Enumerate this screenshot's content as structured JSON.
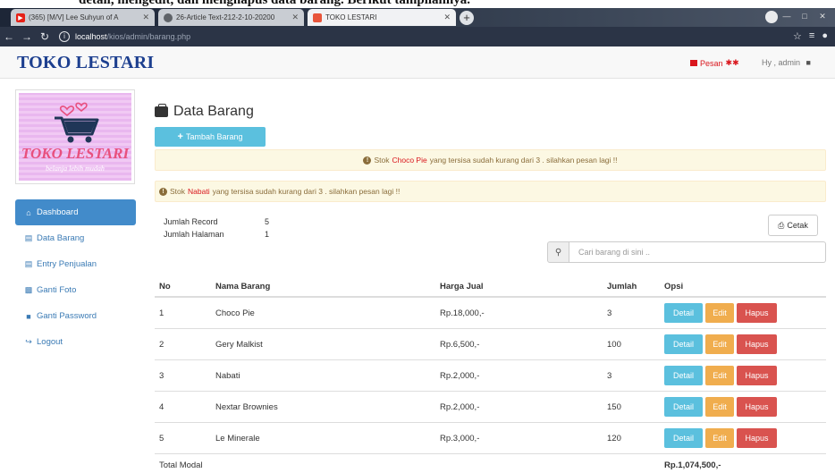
{
  "doc_fragment": "detail, mengedit, dan menghapus data barang. Berikut tampilannya.",
  "browser": {
    "tabs": [
      {
        "label": "(365) [M/V] Lee Suhyun of A",
        "favicon_color": "#e62117"
      },
      {
        "label": "26-Article Text-212-2-10-20200",
        "favicon_color": "#5f6368"
      },
      {
        "label": "TOKO LESTARI",
        "favicon_color": "#e8553b"
      }
    ],
    "address_host": "localhost",
    "address_path": "/kios/admin/barang.php"
  },
  "header": {
    "brand": "TOKO LESTARI",
    "pesan_label": "Pesan",
    "pesan_badge": "✱✱",
    "greeting": "Hy , admin"
  },
  "logo": {
    "title": "TOKO LESTARI",
    "tagline": "belanja lebih mudah"
  },
  "sidebar": {
    "items": [
      {
        "label": "Dashboard",
        "icon": "home-icon",
        "active": true
      },
      {
        "label": "Data Barang",
        "icon": "database-icon"
      },
      {
        "label": "Entry Penjualan",
        "icon": "database-icon"
      },
      {
        "label": "Ganti Foto",
        "icon": "picture-icon"
      },
      {
        "label": "Ganti Password",
        "icon": "lock-icon"
      },
      {
        "label": "Logout",
        "icon": "logout-icon"
      }
    ]
  },
  "main": {
    "title": "Data Barang",
    "add_button": "Tambah Barang",
    "alerts": [
      {
        "prefix": "Stok",
        "item": "Choco Pie",
        "suffix": "yang tersisa sudah kurang dari 3 . silahkan pesan lagi !!"
      },
      {
        "prefix": "Stok",
        "item": "Nabati",
        "suffix": "yang tersisa sudah kurang dari 3 . silahkan pesan lagi !!"
      }
    ],
    "meta": {
      "jumlah_record_label": "Jumlah Record",
      "jumlah_record_value": "5",
      "jumlah_halaman_label": "Jumlah Halaman",
      "jumlah_halaman_value": "1"
    },
    "print_button": "Cetak",
    "search_placeholder": "Cari barang di sini .."
  },
  "table": {
    "headers": {
      "no": "No",
      "nama": "Nama Barang",
      "harga": "Harga Jual",
      "jumlah": "Jumlah",
      "opsi": "Opsi"
    },
    "rows": [
      {
        "no": "1",
        "nama": "Choco Pie",
        "harga": "Rp.18,000,-",
        "jumlah": "3"
      },
      {
        "no": "2",
        "nama": "Gery Malkist",
        "harga": "Rp.6,500,-",
        "jumlah": "100"
      },
      {
        "no": "3",
        "nama": "Nabati",
        "harga": "Rp.2,000,-",
        "jumlah": "3"
      },
      {
        "no": "4",
        "nama": "Nextar Brownies",
        "harga": "Rp.2,000,-",
        "jumlah": "150"
      },
      {
        "no": "5",
        "nama": "Le Minerale",
        "harga": "Rp.3,000,-",
        "jumlah": "120"
      }
    ],
    "buttons": {
      "detail": "Detail",
      "edit": "Edit",
      "hapus": "Hapus"
    },
    "total_label": "Total Modal",
    "total_value": "Rp.1,074,500,-"
  },
  "colors": {
    "brand": "#1d3f8f",
    "primary": "#428bca",
    "info": "#5bc0de",
    "warning": "#f0ad4e",
    "danger": "#d9534f",
    "alert_bg": "#fcf8e3"
  }
}
